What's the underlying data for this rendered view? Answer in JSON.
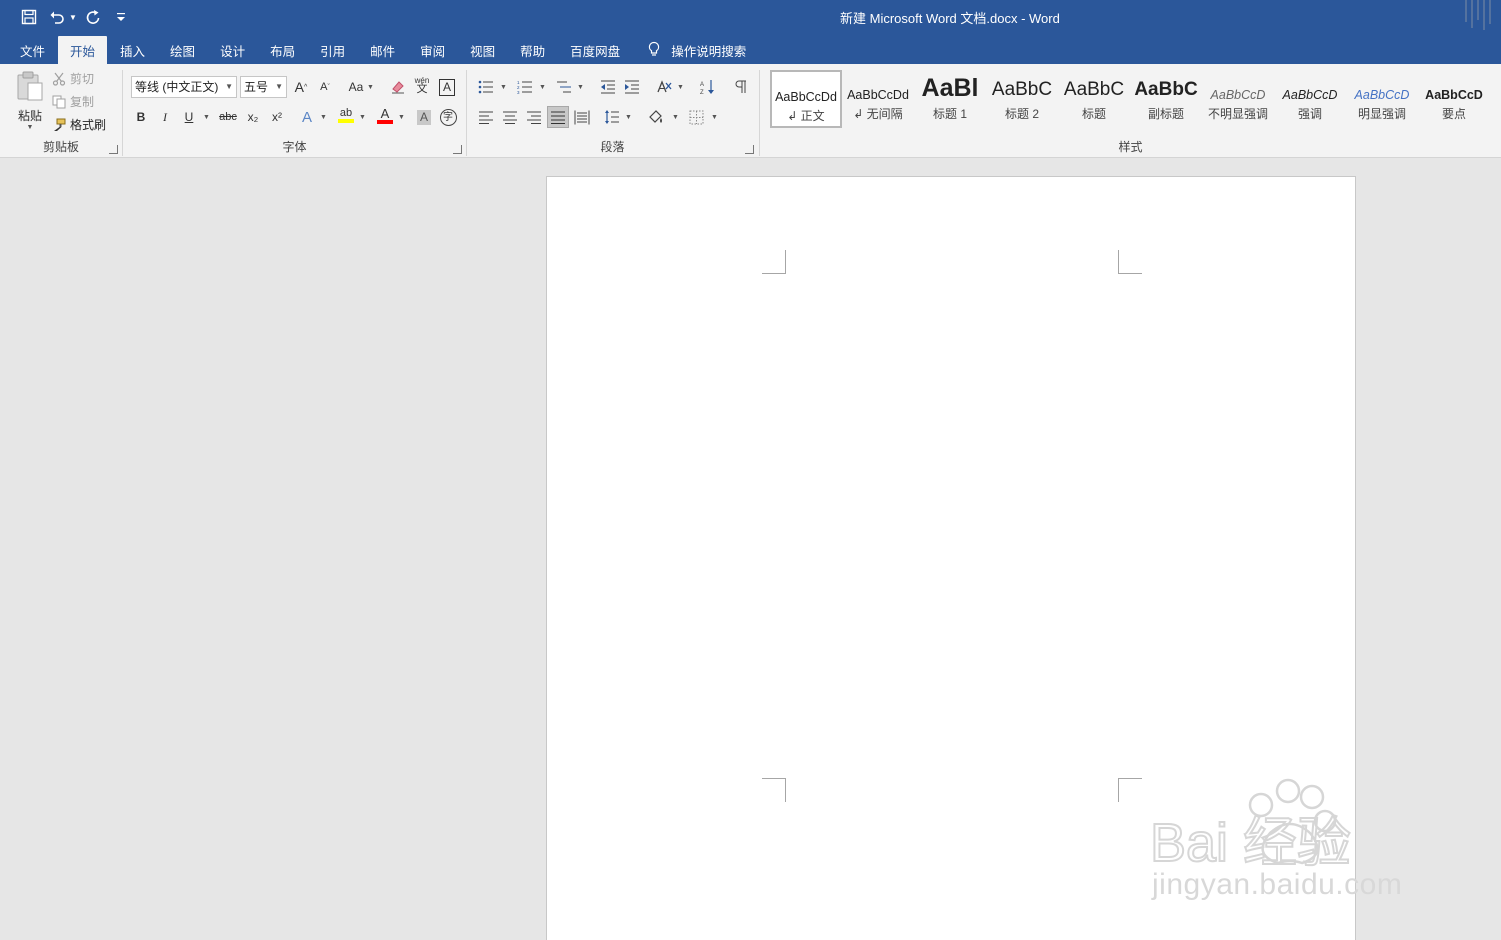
{
  "window": {
    "title": "新建 Microsoft Word 文档.docx  -  Word"
  },
  "qat": {
    "icons": [
      "save-icon",
      "undo-icon",
      "redo-icon",
      "customize-icon"
    ]
  },
  "tabs": [
    {
      "label": "文件",
      "active": false
    },
    {
      "label": "开始",
      "active": true
    },
    {
      "label": "插入",
      "active": false
    },
    {
      "label": "绘图",
      "active": false
    },
    {
      "label": "设计",
      "active": false
    },
    {
      "label": "布局",
      "active": false
    },
    {
      "label": "引用",
      "active": false
    },
    {
      "label": "邮件",
      "active": false
    },
    {
      "label": "审阅",
      "active": false
    },
    {
      "label": "视图",
      "active": false
    },
    {
      "label": "帮助",
      "active": false
    },
    {
      "label": "百度网盘",
      "active": false
    }
  ],
  "tellme": {
    "label": "操作说明搜索",
    "icon": "lightbulb-icon"
  },
  "clipboard": {
    "group_label": "剪贴板",
    "paste": "粘贴",
    "cut": "剪切",
    "copy": "复制",
    "format_painter": "格式刷"
  },
  "font": {
    "group_label": "字体",
    "font_name": "等线 (中文正文)",
    "font_size": "五号",
    "grow": "A",
    "shrink": "A",
    "change_case": "Aa",
    "bold": "B",
    "italic": "I",
    "underline": "U",
    "strikethrough": "abc",
    "subscript": "x₂",
    "superscript": "x²",
    "text_effects": "A",
    "highlight": "ab",
    "font_color": "A",
    "char_shading": "A",
    "enclose": "字",
    "phonetic_top": "wén",
    "phonetic_bottom": "文",
    "border_char": "A",
    "colors": {
      "highlight": "#ffff00",
      "font_color": "#ff0000"
    }
  },
  "paragraph": {
    "group_label": "段落"
  },
  "styles": {
    "group_label": "样式",
    "items": [
      {
        "sample": "AaBbCcDd",
        "name": "↲ 正文"
      },
      {
        "sample": "AaBbCcDd",
        "name": "↲ 无间隔"
      },
      {
        "sample": "AaBl",
        "name": "标题 1"
      },
      {
        "sample": "AaBbC",
        "name": "标题 2"
      },
      {
        "sample": "AaBbC",
        "name": "标题"
      },
      {
        "sample": "AaBbC",
        "name": "副标题"
      },
      {
        "sample": "AaBbCcD",
        "name": "不明显强调"
      },
      {
        "sample": "AaBbCcD",
        "name": "强调"
      },
      {
        "sample": "AaBbCcD",
        "name": "明显强调"
      },
      {
        "sample": "AaBbCcD",
        "name": "要点"
      }
    ],
    "selected_index": 0
  },
  "watermark": {
    "brand": "Bai 经验",
    "domain": "jingyan.baidu.com"
  },
  "colors": {
    "brand": "#2b579a",
    "ribbon_bg": "#f3f3f3",
    "canvas_bg": "#e6e6e6",
    "page_bg": "#ffffff"
  }
}
